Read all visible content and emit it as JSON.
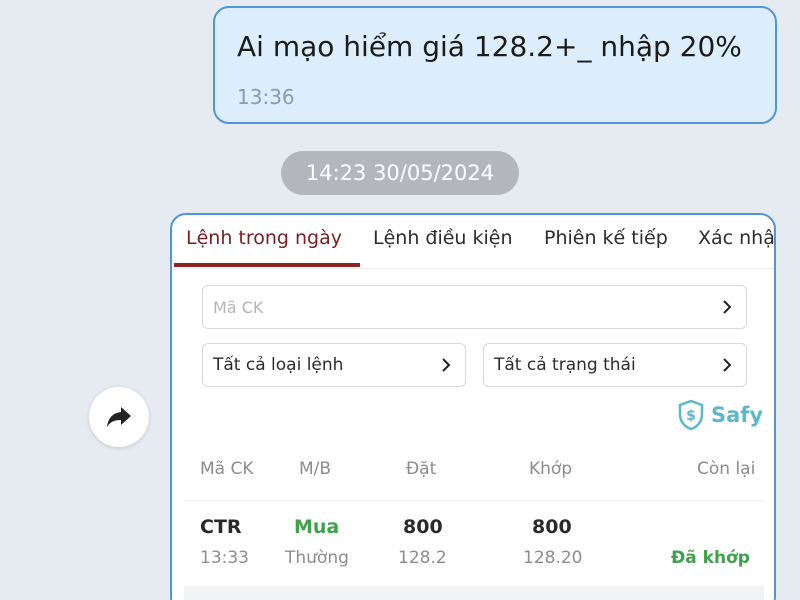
{
  "message": {
    "text": "Ai mạo hiểm giá 128.2+_ nhập 20%",
    "time": "13:36"
  },
  "date_divider": "14:23 30/05/2024",
  "forward_icon": "share-arrow-icon",
  "order_card": {
    "tabs": [
      {
        "label": "Lệnh trong ngày",
        "active": true
      },
      {
        "label": "Lệnh điều kiện",
        "active": false
      },
      {
        "label": "Phiên kế tiếp",
        "active": false
      },
      {
        "label": "Xác nhậ",
        "active": false
      }
    ],
    "symbol_input_placeholder": "Mã CK",
    "order_type_filter": "Tất cả loại lệnh",
    "status_filter": "Tất cả trạng thái",
    "brand": {
      "label": "Safy",
      "icon": "shield-dollar-icon",
      "color": "#5db7c8"
    },
    "columns": [
      "Mã CK",
      "M/B",
      "Đặt",
      "Khớp",
      "Còn lại"
    ],
    "orders": [
      {
        "symbol": "CTR",
        "time": "13:33",
        "side": "Mua",
        "order_type": "Thường",
        "placed_qty": "800",
        "placed_price": "128.2",
        "matched_qty": "800",
        "matched_price": "128.20",
        "remaining": "",
        "status": "Đã khớp"
      }
    ]
  },
  "colors": {
    "accent_tab": "#8c2329",
    "bubble_bg": "#dcedfb",
    "bubble_border": "#4f95d8",
    "buy_green": "#3fa14a"
  }
}
